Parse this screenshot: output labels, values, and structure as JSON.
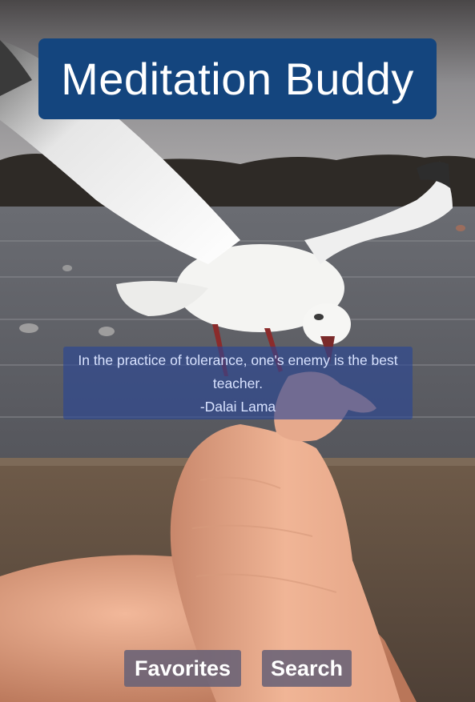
{
  "app": {
    "title": "Meditation Buddy"
  },
  "quote": {
    "text": "In the practice of tolerance, one's enemy is the best teacher.",
    "author": "-Dalai Lama"
  },
  "nav": {
    "favorites_label": "Favorites",
    "search_label": "Search"
  },
  "colors": {
    "title_bg": "#14457e",
    "quote_bg": "rgba(40,70,150,0.62)",
    "button_bg": "rgba(105,98,118,0.88)"
  },
  "background_photo": "seagull-feeding-from-hand-by-lake"
}
